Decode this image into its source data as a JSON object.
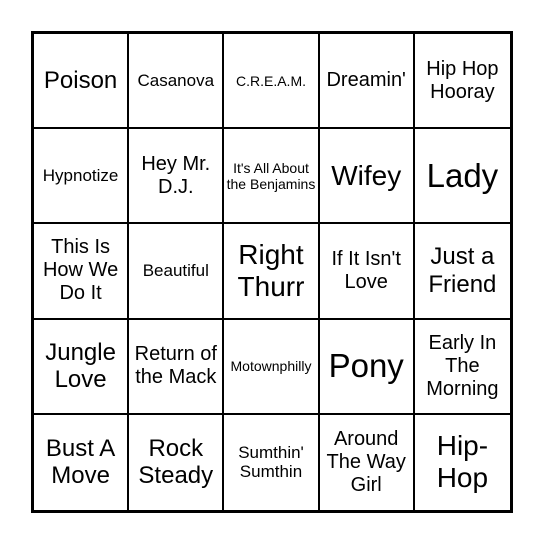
{
  "board": {
    "cells": [
      [
        "Poison",
        "Casanova",
        "C.R.E.A.M.",
        "Dreamin'",
        "Hip Hop Hooray"
      ],
      [
        "Hypnotize",
        "Hey Mr. D.J.",
        "It's All About the Benjamins",
        "Wifey",
        "Lady"
      ],
      [
        "This Is How We Do It",
        "Beautiful",
        "Right Thurr",
        "If It Isn't Love",
        "Just a Friend"
      ],
      [
        "Jungle Love",
        "Return of the Mack",
        "Motownphilly",
        "Pony",
        "Early In The Morning"
      ],
      [
        "Bust A Move",
        "Rock Steady",
        "Sumthin' Sumthin",
        "Around The Way Girl",
        "Hip-Hop"
      ]
    ]
  }
}
